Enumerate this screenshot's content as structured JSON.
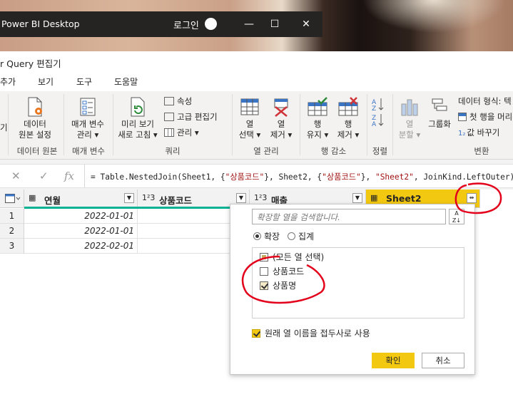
{
  "pbi_window": {
    "title": "Power BI Desktop",
    "login_label": "로그인",
    "minimize_glyph": "—",
    "maximize_glyph": "☐",
    "close_glyph": "✕"
  },
  "editor": {
    "title": "r Query 편집기",
    "menu": [
      "추가",
      "보기",
      "도구",
      "도움말"
    ]
  },
  "ribbon": {
    "left_cut_label": "기",
    "data_source_btn": [
      "데이터",
      "원본 설정"
    ],
    "params_btn": [
      "매개 변수",
      "관리 ▾"
    ],
    "preview_btn": [
      "미리 보기",
      "새로 고침 ▾"
    ],
    "query_small": [
      "속성",
      "고급 편집기",
      "관리 ▾"
    ],
    "select_col_btn": [
      "열",
      "선택 ▾"
    ],
    "remove_col_btn": [
      "열",
      "제거 ▾"
    ],
    "keep_rows_btn": [
      "행",
      "유지 ▾"
    ],
    "remove_rows_btn": [
      "행",
      "제거 ▾"
    ],
    "split_btn": [
      "열",
      "분할 ▾"
    ],
    "group_btn": "그룹화",
    "transform_small": [
      "데이터 형식: 텍",
      "첫 행을 머리",
      "값 바꾸기"
    ],
    "groups": {
      "datasource": "데이터 원본",
      "params": "매개 변수",
      "query": "쿼리",
      "colmgmt": "열 관리",
      "rowreduce": "행 감소",
      "sort": "정렬",
      "transform": "변환"
    }
  },
  "formula_bar": {
    "cancel_glyph": "✕",
    "commit_glyph": "✓",
    "fx_label": "fx",
    "parts": [
      "= Table.NestedJoin(Sheet1, {",
      "\"상품코드\"",
      "}, Sheet2, {",
      "\"상품코드\"",
      "}, ",
      "\"Sheet2\"",
      ", JoinKind.LeftOuter)"
    ]
  },
  "table": {
    "columns": [
      {
        "type": "▦",
        "label": "연월"
      },
      {
        "type": "1²3",
        "label": "상품코드"
      },
      {
        "type": "1²3",
        "label": "매출"
      },
      {
        "type": "▦",
        "label": "Sheet2"
      }
    ],
    "rows": [
      {
        "n": "1",
        "date": "2022-01-01"
      },
      {
        "n": "2",
        "date": "2022-01-01"
      },
      {
        "n": "3",
        "date": "2022-02-01"
      }
    ]
  },
  "expand_popup": {
    "search_placeholder": "확장할 열을 검색합니다.",
    "radio_expand": "확장",
    "radio_aggregate": "집계",
    "select_all": "(모든 열 선택)",
    "items": [
      {
        "label": "상품코드",
        "checked": false
      },
      {
        "label": "상품명",
        "checked": true
      }
    ],
    "use_prefix": "원래 열 이름을 접두사로 사용",
    "ok": "확인",
    "cancel": "취소"
  },
  "colors": {
    "accent_yellow": "#f2c811",
    "annotation_red": "#e3001b",
    "teal_quality": "#00b294"
  }
}
